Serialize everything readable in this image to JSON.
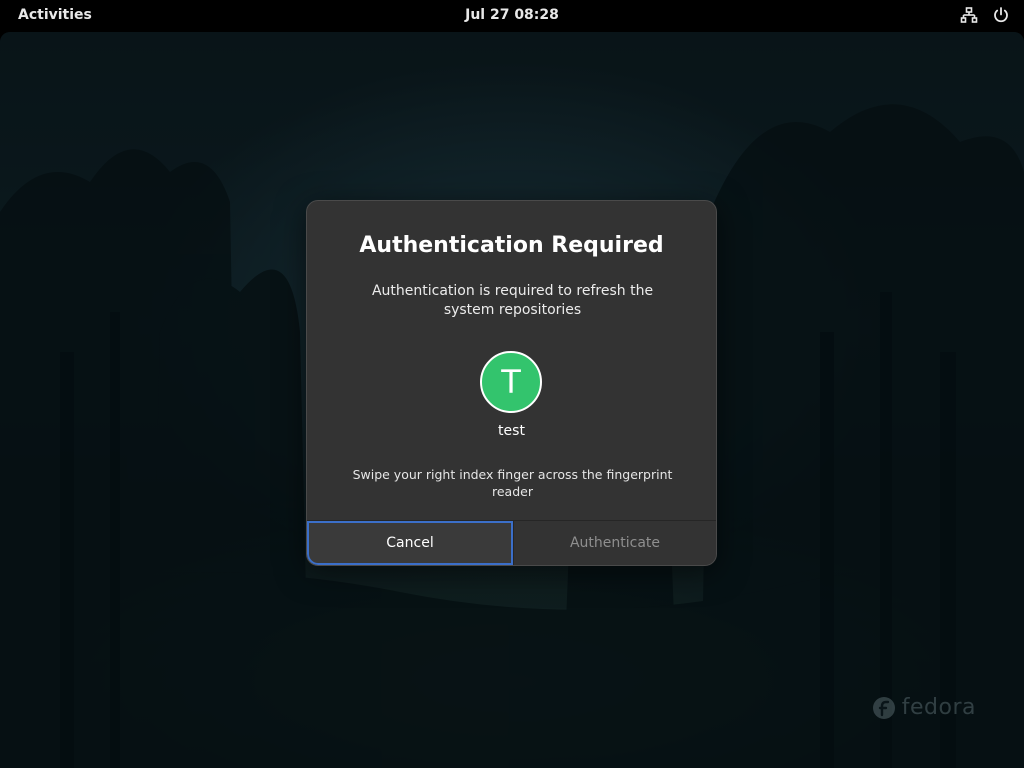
{
  "topbar": {
    "activities_label": "Activities",
    "clock": "Jul 27  08:28",
    "tray": {
      "network_icon": "network-wired-icon",
      "power_icon": "power-icon"
    }
  },
  "desktop": {
    "watermark_text": "fedora",
    "watermark_logo": "fedora-logo-icon"
  },
  "dialog": {
    "title": "Authentication Required",
    "description": "Authentication is required to refresh the system repositories",
    "avatar_initial": "T",
    "avatar_color": "#33c46d",
    "username": "test",
    "prompt": "Swipe your right index finger across the fingerprint reader",
    "buttons": {
      "cancel": "Cancel",
      "authenticate": "Authenticate"
    }
  },
  "colors": {
    "dialog_bg": "#333333",
    "focus_ring": "#3b6fc9",
    "disabled_text": "#8f8f8f"
  }
}
